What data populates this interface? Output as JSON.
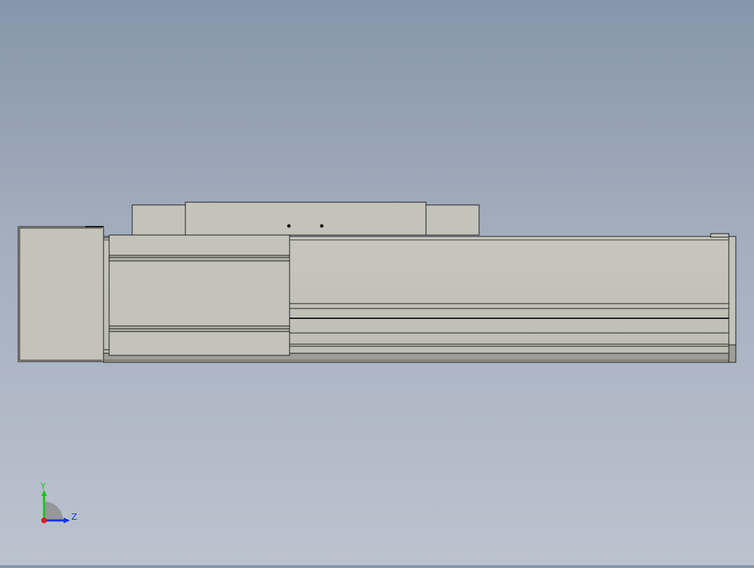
{
  "viewport": {
    "background_top": "#8796aa",
    "background_bottom": "#bcc3cf"
  },
  "model": {
    "part_fill": "#c3c3b9",
    "part_fill_dark": "#9e9e96",
    "edge_color": "#1a1a1a"
  },
  "triad": {
    "y_label": "Y",
    "z_label": "Z",
    "y_color": "#19c419",
    "z_color": "#1530e0",
    "x_color": "#e01818"
  }
}
